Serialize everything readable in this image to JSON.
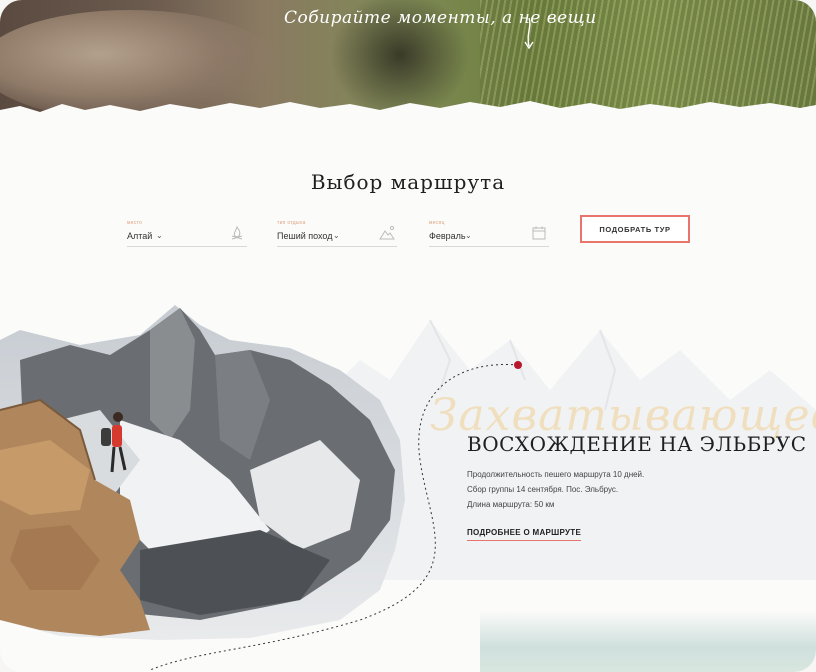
{
  "hero": {
    "tagline": "Собирайте моменты, а не вещи"
  },
  "route_picker": {
    "title": "Выбор маршрута",
    "filters": [
      {
        "label": "место",
        "value": "Алтай",
        "icon": "campfire-icon"
      },
      {
        "label": "тип отдыха",
        "value": "Пеший поход",
        "icon": "mountain-icon"
      },
      {
        "label": "месяц",
        "value": "Февраль",
        "icon": "calendar-icon"
      }
    ],
    "submit_label": "ПОДОБРАТЬ ТУР"
  },
  "featured_route": {
    "script_word": "Захватывающее",
    "title": "ВОСХОЖДЕНИЕ НА ЭЛЬБРУС",
    "lines": [
      "Продолжительность пешего маршрута 10 дней.",
      "Сбор группы 14 сентября. Пос. Эльбрус.",
      "Длина маршрута: 50 км"
    ],
    "link_label": "ПОДРОБНЕЕ О МАРШРУТЕ"
  },
  "colors": {
    "accent": "#e8756c",
    "path_dot": "#b7182b",
    "script": "#f0d9ad"
  }
}
